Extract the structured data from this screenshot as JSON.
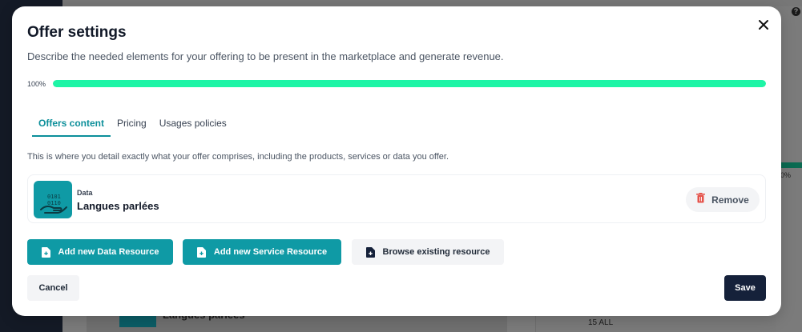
{
  "background": {
    "help_glyph": "?",
    "progress_peek": "0%",
    "card_title": "Langues parlées",
    "footer_count": "15 ALL"
  },
  "modal": {
    "title": "Offer settings",
    "description": "Describe the needed elements for your offering to be present in the marketplace and generate revenue.",
    "close_icon": "close-icon"
  },
  "progress": {
    "label": "100%",
    "value": 100,
    "color": "#1ef5a6"
  },
  "tabs": [
    {
      "label": "Offers content",
      "active": true
    },
    {
      "label": "Pricing",
      "active": false
    },
    {
      "label": "Usages policies",
      "active": false
    }
  ],
  "content": {
    "description": "This is where you detail exactly what your offer comprises, including the products, services or data you offer."
  },
  "resource": {
    "type": "Data",
    "name": "Langues parlées",
    "icon": "data-binary-hand-icon",
    "remove_label": "Remove"
  },
  "actions": {
    "add_data": "Add new Data Resource",
    "add_service": "Add new Service Resource",
    "browse": "Browse existing resource",
    "cancel": "Cancel",
    "save": "Save"
  },
  "colors": {
    "accent": "#0f9aa5",
    "primary_dark": "#15213a",
    "danger": "#e5534b"
  }
}
